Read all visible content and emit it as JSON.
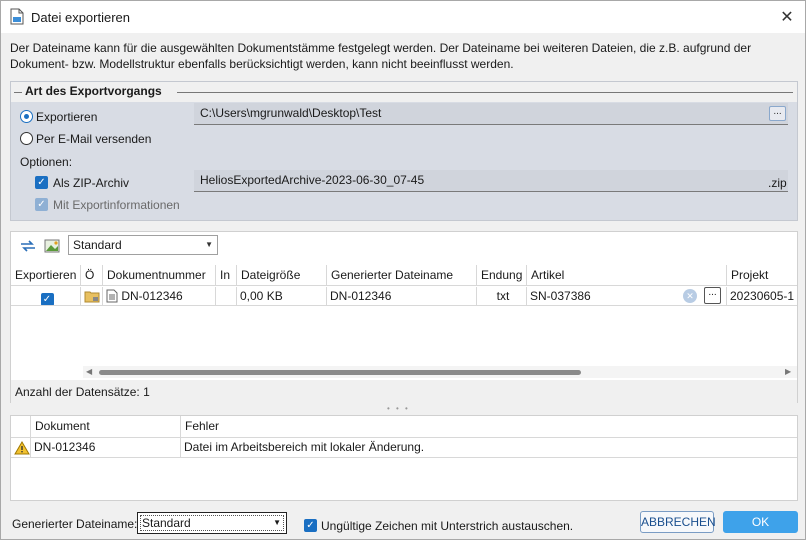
{
  "window": {
    "title": "Datei exportieren",
    "description": "Der Dateiname kann für die ausgewählten Dokumentstämme festgelegt werden. Der Dateiname bei weiteren Dateien, die z.B. aufgrund der Dokument- bzw. Modellstruktur ebenfalls berücksichtigt werden, kann nicht beeinflusst werden."
  },
  "export_group": {
    "title": "Art des Exportvorgangs",
    "radio_export": "Exportieren",
    "radio_email": "Per E-Mail versenden",
    "selected": "Exportieren",
    "path": "C:\\Users\\mgrunwald\\Desktop\\Test",
    "browse_label": "...",
    "options_label": "Optionen:",
    "zip_label": "Als ZIP-Archiv",
    "zip_checked": true,
    "info_label": "Mit Exportinformationen",
    "info_checked": true,
    "archive_name": "HeliosExportedArchive-2023-06-30_07-45",
    "archive_ext": ".zip"
  },
  "grid": {
    "view_select": "Standard",
    "columns": [
      "Exportieren",
      "Ö",
      "Dokumentnummer",
      "In",
      "Dateigröße",
      "Generierter Dateiname",
      "Endung",
      "Artikel",
      "Projekt"
    ],
    "rows": [
      {
        "export": true,
        "document_number": "DN-012346",
        "in": "",
        "size": "0,00 KB",
        "generated_name": "DN-012346",
        "extension": "txt",
        "article": "SN-037386",
        "article_button": "...",
        "project": "20230605-1"
      }
    ],
    "record_count": "Anzahl der Datensätze: 1"
  },
  "errors": {
    "columns": [
      "Dokument",
      "Fehler"
    ],
    "rows": [
      {
        "document": "DN-012346",
        "message": "Datei im Arbeitsbereich mit lokaler Änderung."
      }
    ]
  },
  "footer": {
    "generated_name_label": "Generierter Dateiname:",
    "generated_name_value": "Standard",
    "replace_label": "Ungültige Zeichen mit Unterstrich austauschen.",
    "replace_checked": true,
    "cancel": "ABBRECHEN",
    "ok": "OK"
  },
  "colors": {
    "accent": "#1a6fc2",
    "ok_button": "#3ea2ea",
    "group_bg": "#d8dce4"
  }
}
